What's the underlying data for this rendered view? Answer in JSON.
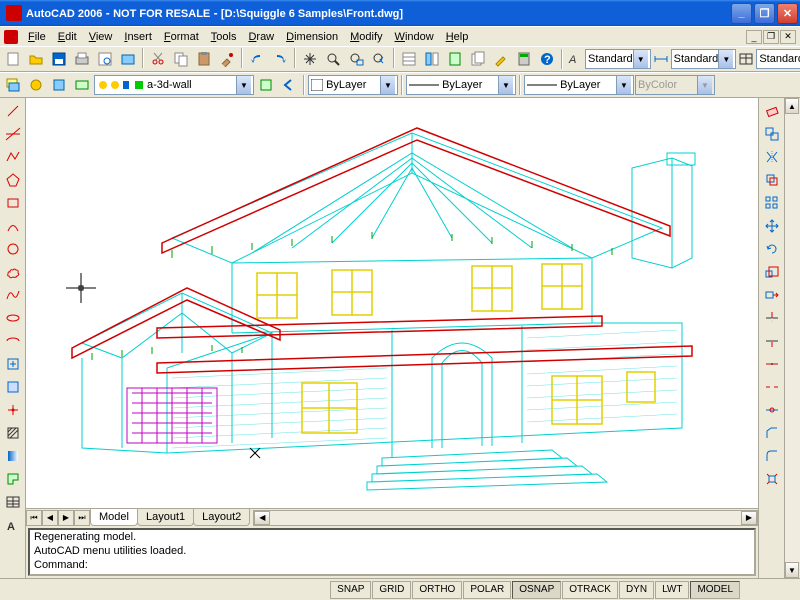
{
  "titlebar": {
    "app": "AutoCAD 2006",
    "note": "NOT FOR RESALE",
    "doc": "[D:\\Squiggle 6 Samples\\Front.dwg]"
  },
  "menus": [
    "File",
    "Edit",
    "View",
    "Insert",
    "Format",
    "Tools",
    "Draw",
    "Dimension",
    "Modify",
    "Window",
    "Help"
  ],
  "toolbar1_icons": [
    "new",
    "open",
    "save",
    "plot",
    "plot-preview",
    "publish",
    "cut",
    "copy",
    "paste",
    "match-prop",
    "undo",
    "redo",
    "pan",
    "zoom-rt",
    "zoom-win",
    "zoom-prev",
    "properties",
    "design-center",
    "tool-palettes",
    "sheet-set",
    "markup",
    "qcalc",
    "help"
  ],
  "styles": {
    "text": "Standard",
    "dim": "Standard",
    "table": "Standard"
  },
  "layers": {
    "current": "a-3d-wall",
    "icons": [
      "layer-props",
      "layer-states",
      "layer-filter",
      "layer-prev"
    ]
  },
  "props": {
    "color": "ByLayer",
    "linetype": "ByLayer",
    "lineweight": "ByLayer",
    "plotstyle": "ByColor"
  },
  "draw_tools": [
    "line",
    "xline",
    "pline",
    "polygon",
    "rectangle",
    "arc",
    "circle",
    "revcloud",
    "spline",
    "ellipse",
    "ellipse-arc",
    "insert",
    "block",
    "point",
    "hatch",
    "gradient",
    "region",
    "table",
    "mtext"
  ],
  "modify_tools": [
    "erase",
    "copy",
    "mirror",
    "offset",
    "array",
    "move",
    "rotate",
    "scale",
    "stretch",
    "trim",
    "extend",
    "break-pt",
    "break",
    "join",
    "chamfer",
    "fillet",
    "explode"
  ],
  "tabs": [
    "Model",
    "Layout1",
    "Layout2"
  ],
  "active_tab": "Model",
  "command": {
    "lines": [
      "Regenerating model.",
      "AutoCAD menu utilities loaded."
    ],
    "prompt": "Command:"
  },
  "status_modes": [
    {
      "label": "SNAP",
      "on": false
    },
    {
      "label": "GRID",
      "on": false
    },
    {
      "label": "ORTHO",
      "on": false
    },
    {
      "label": "POLAR",
      "on": false
    },
    {
      "label": "OSNAP",
      "on": true
    },
    {
      "label": "OTRACK",
      "on": false
    },
    {
      "label": "DYN",
      "on": false
    },
    {
      "label": "LWT",
      "on": false
    },
    {
      "label": "MODEL",
      "on": true
    }
  ],
  "colors": {
    "titlebar": "#0f5fd8",
    "wire_cyan": "#00e0e0",
    "wire_red": "#d00000",
    "wire_yellow": "#f0e000",
    "wire_green": "#00c000",
    "wire_magenta": "#d000d0"
  }
}
